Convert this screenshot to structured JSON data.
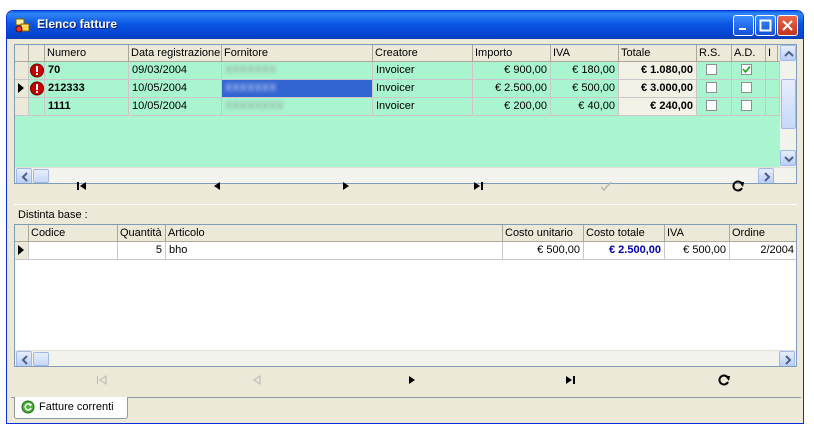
{
  "window": {
    "title": "Elenco fatture"
  },
  "invoices": {
    "columns": [
      "Numero",
      "Data registrazione",
      "Fornitore",
      "Creatore",
      "Importo",
      "IVA",
      "Totale",
      "R.S.",
      "A.D.",
      "I"
    ],
    "rows": [
      {
        "numero": "70",
        "data": "09/03/2004",
        "fornitore": "XXXXXXX",
        "creatore": "Invoicer",
        "importo": "€ 900,00",
        "iva": "€ 180,00",
        "totale": "€ 1.080,00",
        "rs": false,
        "ad": true,
        "warning": true,
        "current": false
      },
      {
        "numero": "212333",
        "data": "10/05/2004",
        "fornitore": "XXXXXXX",
        "creatore": "Invoicer",
        "importo": "€ 2.500,00",
        "iva": "€ 500,00",
        "totale": "€ 3.000,00",
        "rs": false,
        "ad": false,
        "warning": true,
        "current": true
      },
      {
        "numero": "1111",
        "data": "10/05/2004",
        "fornitore": "XXXXXXXX",
        "creatore": "Invoicer",
        "importo": "€ 200,00",
        "iva": "€ 40,00",
        "totale": "€ 240,00",
        "rs": false,
        "ad": false,
        "warning": false,
        "current": false
      }
    ]
  },
  "bom": {
    "caption": "Distinta base :",
    "columns": [
      "Codice",
      "Quantità",
      "Articolo",
      "Costo unitario",
      "Costo totale",
      "IVA",
      "Ordine"
    ],
    "rows": [
      {
        "codice": "",
        "quantita": "5",
        "articolo": "bho",
        "costo_unitario": "€ 500,00",
        "costo_totale": "€ 2.500,00",
        "iva": "€ 500,00",
        "ordine": "2/2004"
      }
    ]
  },
  "tabs": [
    {
      "label": "Fatture correnti"
    }
  ],
  "icons": {
    "navigation": [
      "first-record-icon",
      "previous-record-icon",
      "next-record-icon",
      "last-record-icon",
      "confirm-icon",
      "refresh-icon"
    ],
    "warning": "warning-icon",
    "row_indicator": "current-row-icon"
  },
  "colors": {
    "row_background": "#a9f5cf",
    "selection": "#3264d2",
    "total_cost": "#0000b0",
    "title_bar": "#0b57e3"
  }
}
